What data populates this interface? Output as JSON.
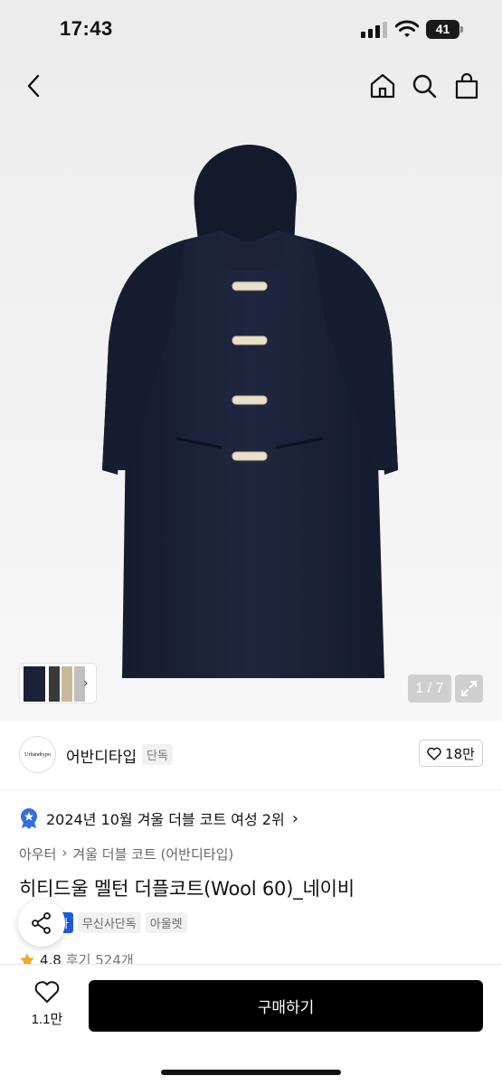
{
  "status_bar": {
    "time": "17:43",
    "battery": "41"
  },
  "nav": {
    "back_icon": "chevron-left-icon",
    "home_icon": "home-icon",
    "search_icon": "search-icon",
    "cart_icon": "bag-icon"
  },
  "gallery": {
    "pager": "1 / 7",
    "expand_icon": "expand-icon"
  },
  "brand": {
    "logo_text": "Urbandtypo",
    "name": "어반디타입",
    "tag": "단독",
    "likes": "18만"
  },
  "ranking": {
    "text": "2024년 10월 겨울 더블 코트 여성 2위"
  },
  "breadcrumb": {
    "items": [
      "아우터",
      "겨울 더블 코트 (어반디타입)"
    ]
  },
  "product": {
    "title": "히티드울 멜턴 더플코트(Wool 60)_네이비"
  },
  "badges": [
    "소타",
    "무신사단독",
    "아울렛"
  ],
  "rating": {
    "score": "4.8",
    "reviews": "후기 524개"
  },
  "bottom": {
    "wish_count": "1.1만",
    "buy_label": "구매하기"
  },
  "colors": {
    "coat": "#1b2237",
    "buy_button": "#000000",
    "badge_blue": "#1e5bdc",
    "rank_blue": "#2f6fe0"
  }
}
